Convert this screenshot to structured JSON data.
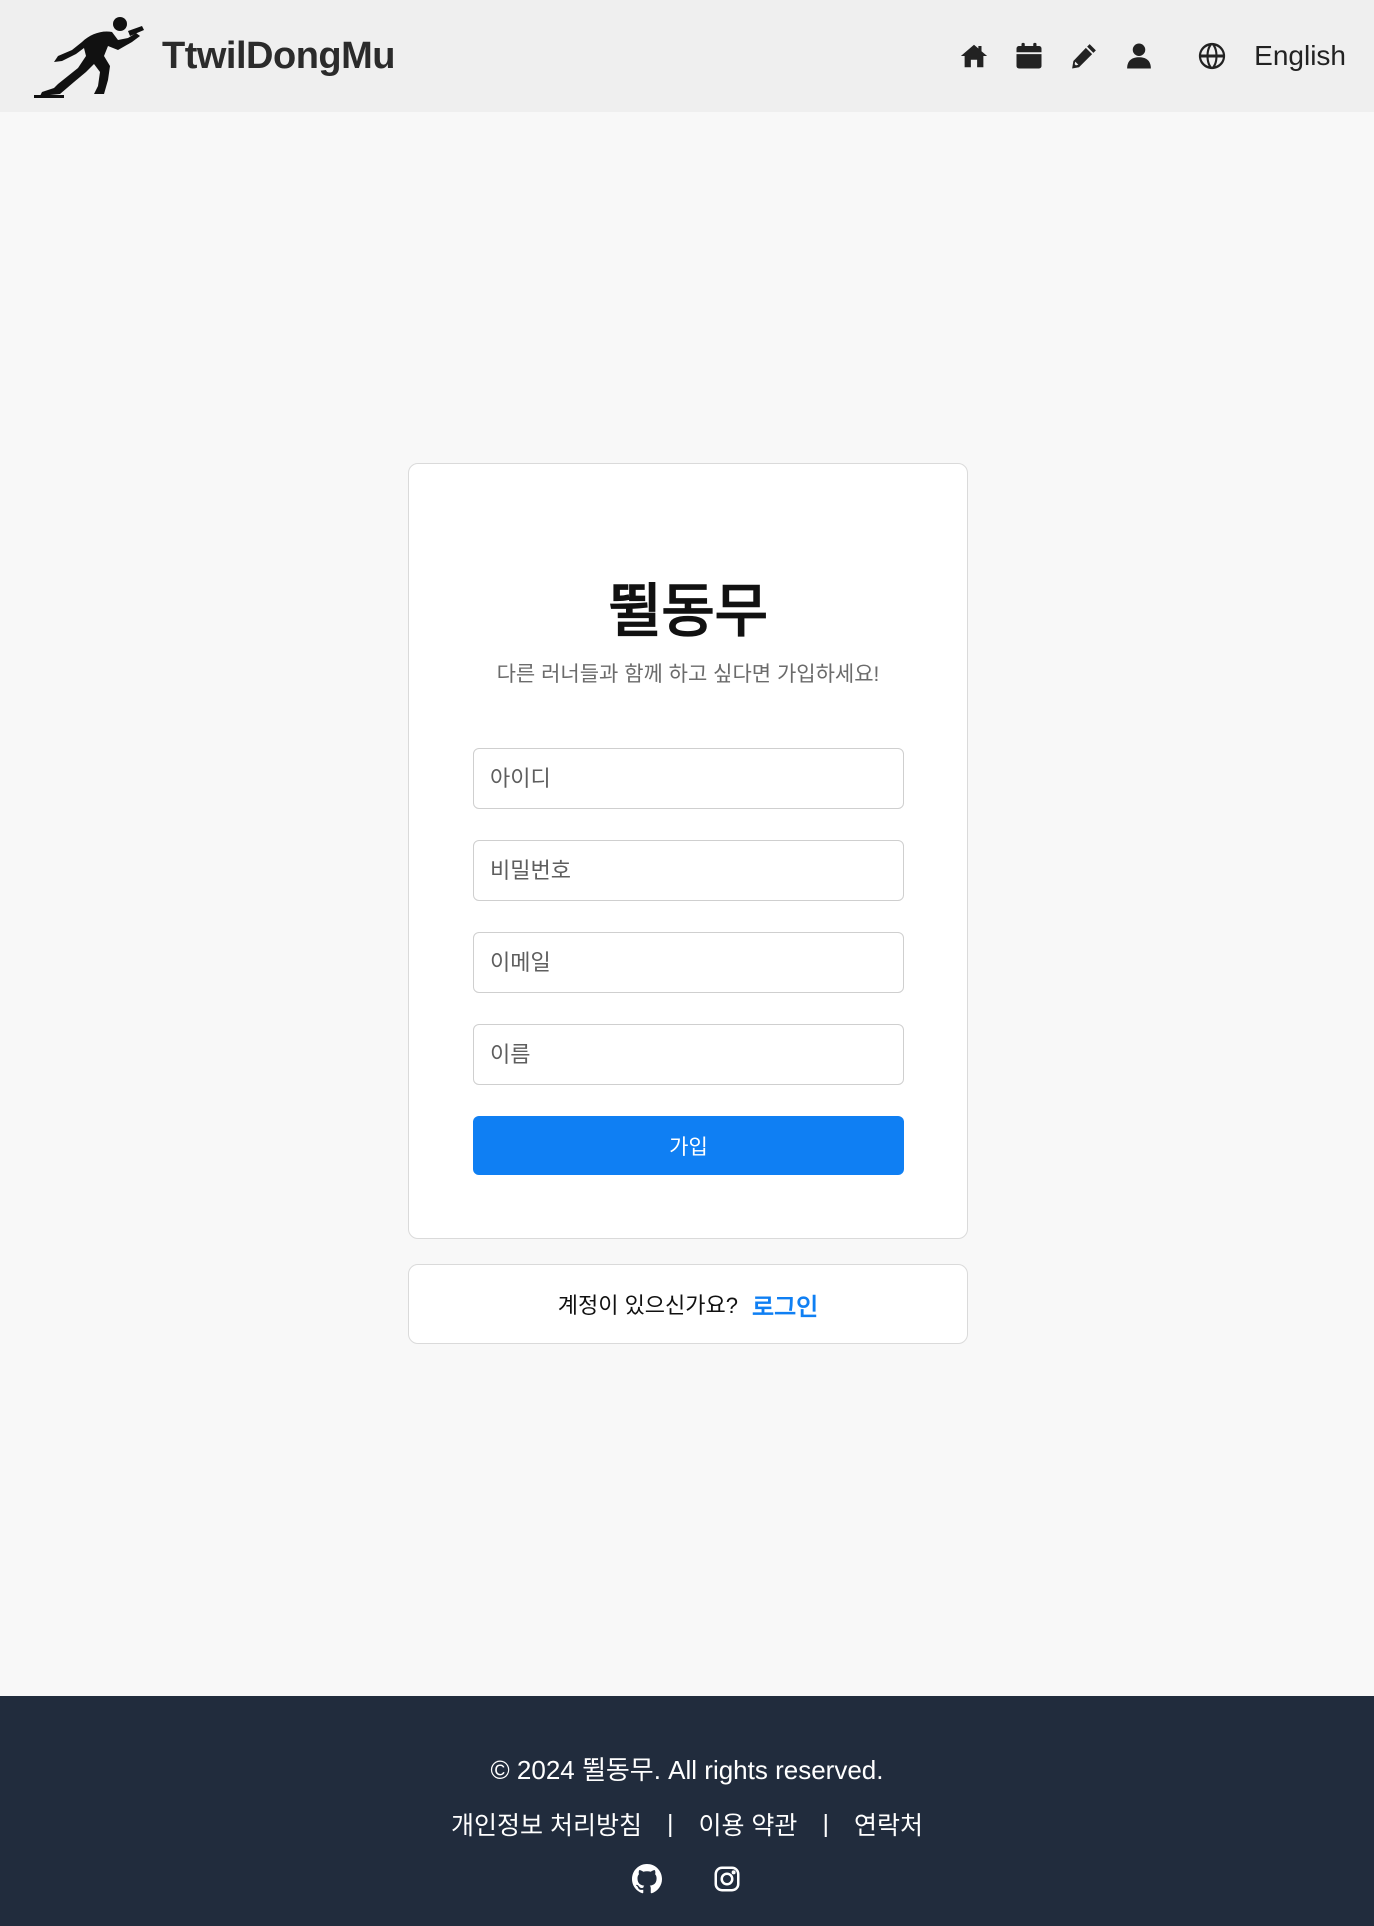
{
  "header": {
    "brand": "TtwilDongMu",
    "language": "English",
    "nav_icons": [
      "home-icon",
      "calendar-icon",
      "pencil-icon",
      "user-icon",
      "globe-icon"
    ]
  },
  "signup": {
    "title": "뛸동무",
    "subtitle": "다른 러너들과 함께 하고 싶다면 가입하세요!",
    "fields": {
      "id_placeholder": "아이디",
      "password_placeholder": "비밀번호",
      "email_placeholder": "이메일",
      "name_placeholder": "이름"
    },
    "submit_label": "가입"
  },
  "login_prompt": {
    "question": "계정이 있으신가요?",
    "link": "로그인"
  },
  "footer": {
    "copyright": "© 2024 뛸동무. All rights reserved.",
    "links": [
      "개인정보 처리방침",
      "이용 약관",
      "연락처"
    ],
    "separator": "|",
    "socials": [
      "github-icon",
      "instagram-icon"
    ]
  },
  "colors": {
    "accent": "#0f7ff3",
    "footer_bg": "#212c3d",
    "header_bg": "#efefef",
    "page_bg": "#f8f8f8"
  }
}
